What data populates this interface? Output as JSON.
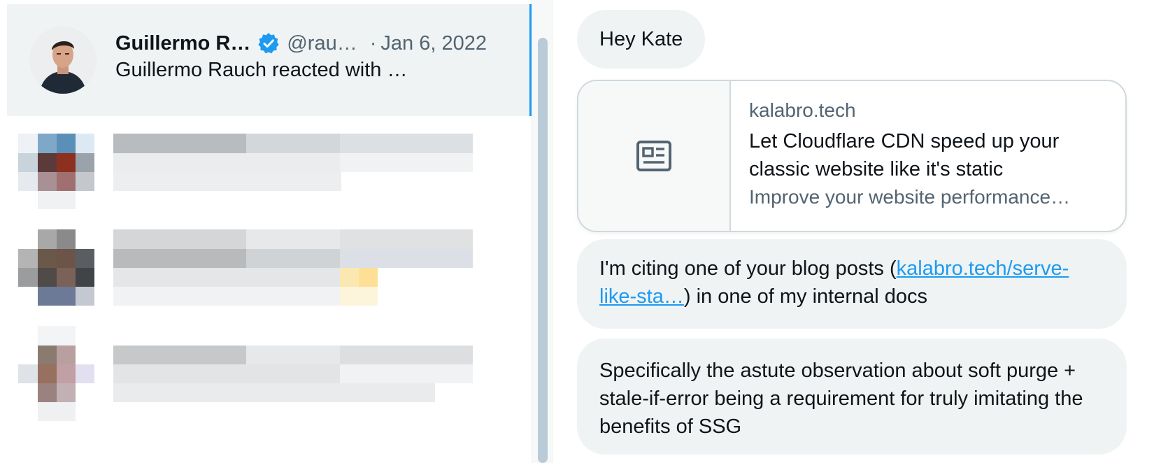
{
  "conversation_list": {
    "active_item": {
      "name": "Guillermo R…",
      "handle": "@rau…",
      "separator": "·",
      "date": "Jan 6, 2022",
      "preview": "Guillermo Rauch reacted with …",
      "verified_icon": "verified-badge-icon"
    }
  },
  "chat": {
    "greeting": "Hey Kate",
    "link_card": {
      "domain": "kalabro.tech",
      "title": "Let Cloudflare CDN speed up your classic website like it's static",
      "description": "Improve your website performance…",
      "thumbnail_icon": "article-icon"
    },
    "cite_message": {
      "before": "I'm citing one of your blog posts (",
      "link": "kalabro.tech/serve-like-sta…",
      "after": ") in one of my internal docs"
    },
    "specific_message": "Specifically the astute observation about soft purge + stale-if-error being a requirement for truly imitating the benefits of SSG"
  },
  "colors": {
    "accent": "#1d9bf0",
    "bubble_bg": "#eff3f4",
    "muted_text": "#536471",
    "scroll_thumb": "#b8cbd7"
  }
}
